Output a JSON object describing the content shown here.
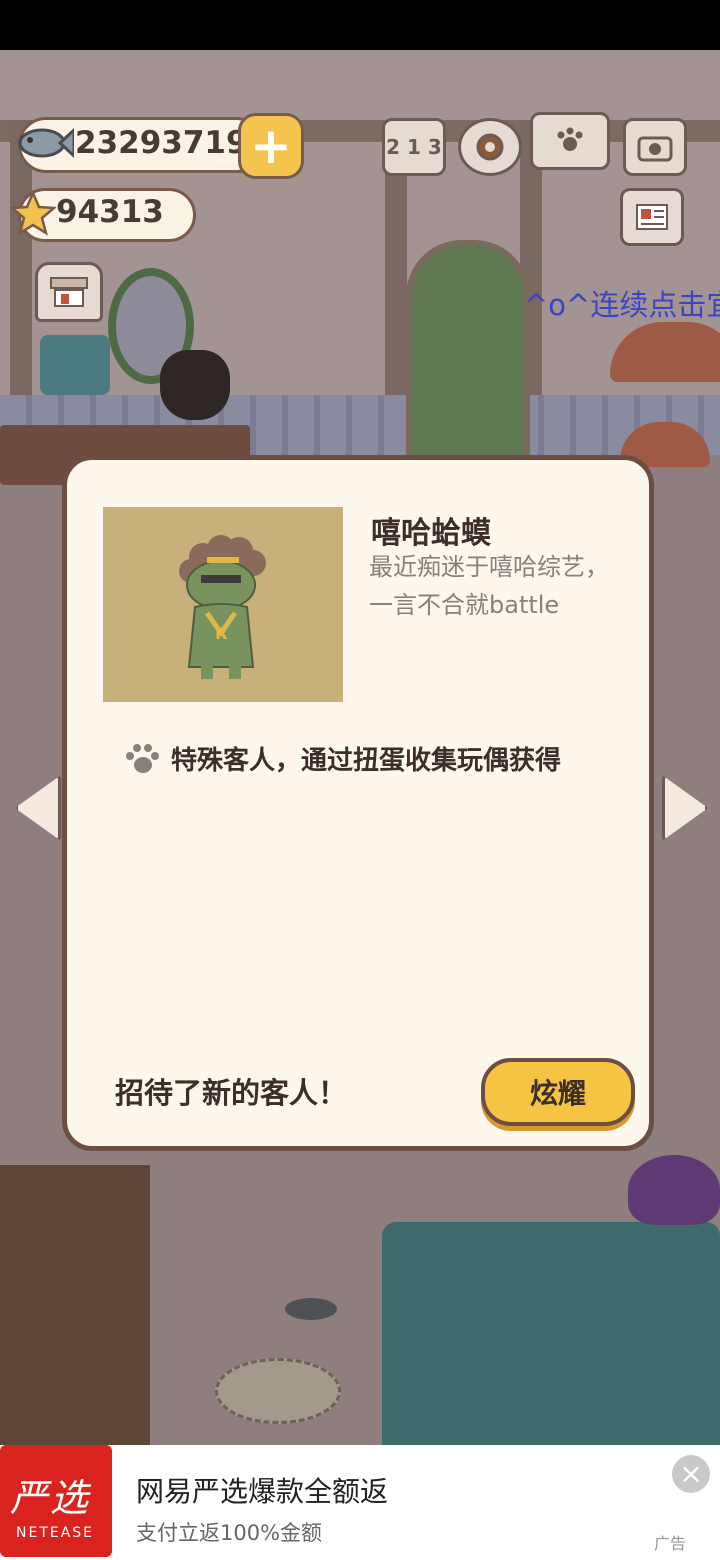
{
  "hud": {
    "coins": "23293719",
    "plus_label": "+",
    "stars": "94313",
    "ranking_label": "2 1 3",
    "hint_text": "^o^连续点击宜"
  },
  "icons": {
    "coin": "fish-icon",
    "star": "star-icon",
    "ranking": "ranking-podium-icon",
    "settings": "gear-icon",
    "catalog": "paw-book-icon",
    "camera": "camera-icon",
    "newspaper": "newspaper-icon",
    "shop": "shop-icon"
  },
  "card": {
    "name": "嘻哈蛤蟆",
    "description_line1": "最近痴迷于嘻哈综艺，",
    "description_line2": "一言不合就battle",
    "special_text": "特殊客人，通过扭蛋收集玩偶获得",
    "footer_text": "招待了新的客人！",
    "show_button": "炫耀"
  },
  "ad": {
    "logo_cn": "严选",
    "logo_en": "NETEASE",
    "title": "网易严选爆款全额返",
    "subtitle": "支付立返100%金额",
    "label": "广告",
    "close": "×"
  },
  "colors": {
    "card_bg": "#fdf7ec",
    "card_border": "#6d4e43",
    "button_yellow": "#f5c443",
    "ad_red": "#d8231f",
    "hint_blue": "#3a45c4"
  }
}
